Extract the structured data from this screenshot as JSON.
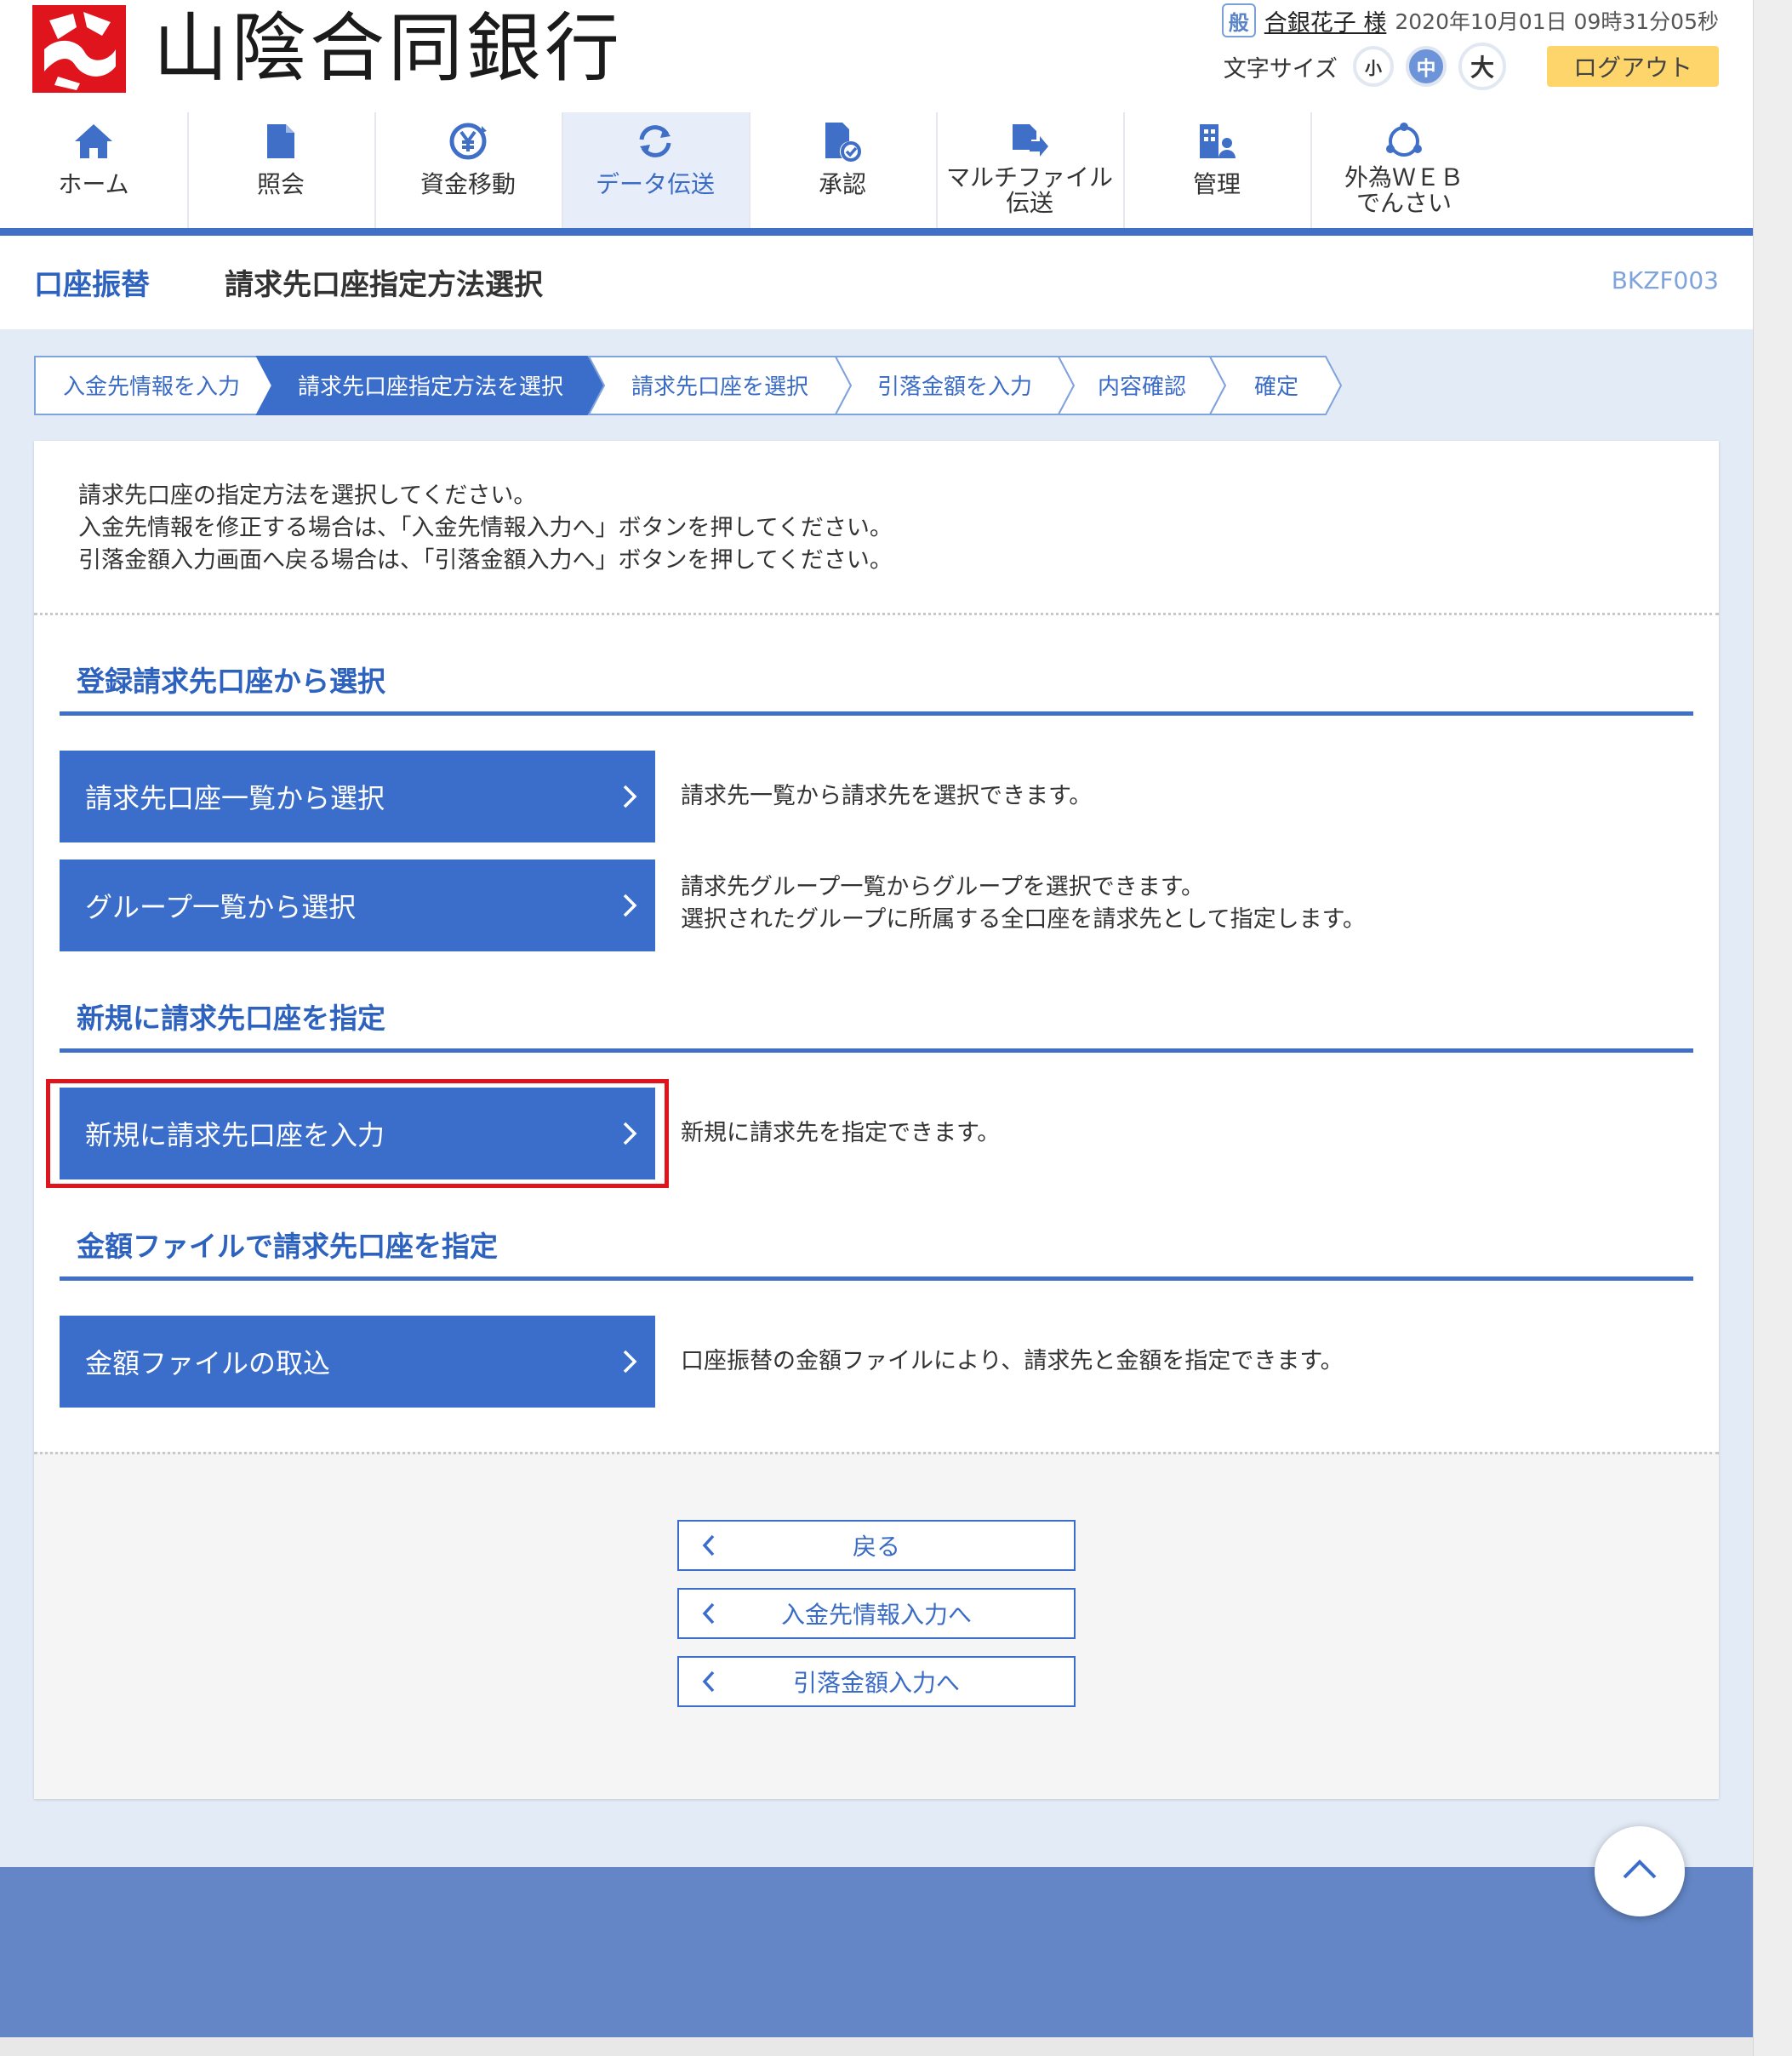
{
  "brand": {
    "name": "山陰合同銀行",
    "logo_text": "ご"
  },
  "user": {
    "badge": "般",
    "name": "合銀花子 様",
    "login_time": "2020年10月01日 09時31分05秒"
  },
  "font_size": {
    "label": "文字サイズ",
    "small": "小",
    "medium": "中",
    "large": "大",
    "selected": "中"
  },
  "logout_label": "ログアウト",
  "nav": {
    "active": "データ伝送",
    "items": [
      {
        "icon": "home-icon",
        "label": "ホーム"
      },
      {
        "icon": "document-icon",
        "label": "照会"
      },
      {
        "icon": "yen-transfer-icon",
        "label": "資金移動"
      },
      {
        "icon": "sync-icon",
        "label": "データ伝送"
      },
      {
        "icon": "approval-icon",
        "label": "承認"
      },
      {
        "icon": "file-transfer-icon",
        "label_line1": "マルチファイル",
        "label_line2": "伝送"
      },
      {
        "icon": "management-icon",
        "label": "管理"
      },
      {
        "icon": "globe-icon",
        "label_line1": "外為ＷＥＢ",
        "label_line2": "でんさい"
      }
    ]
  },
  "title": {
    "category": "口座振替",
    "main": "請求先口座指定方法選択",
    "screen_id": "BKZF003"
  },
  "steps": {
    "current_index": 1,
    "items": [
      "入金先情報を入力",
      "請求先口座指定方法を選択",
      "請求先口座を選択",
      "引落金額を入力",
      "内容確認",
      "確定"
    ]
  },
  "intro": {
    "line1": "請求先口座の指定方法を選択してください。",
    "line2": "入金先情報を修正する場合は、「入金先情報入力へ」ボタンを押してください。",
    "line3": "引落金額入力画面へ戻る場合は、「引落金額入力へ」ボタンを押してください。"
  },
  "sections": {
    "registered": {
      "title": "登録請求先口座から選択",
      "account_list_button": "請求先口座一覧から選択",
      "account_list_desc": "請求先一覧から請求先を選択できます。",
      "group_list_button": "グループ一覧から選択",
      "group_list_desc_line1": "請求先グループ一覧からグループを選択できます。",
      "group_list_desc_line2": "選択されたグループに所属する全口座を請求先として指定します。"
    },
    "new": {
      "title": "新規に請求先口座を指定",
      "button": "新規に請求先口座を入力",
      "desc": "新規に請求先を指定できます。"
    },
    "file": {
      "title": "金額ファイルで請求先口座を指定",
      "button": "金額ファイルの取込",
      "desc": "口座振替の金額ファイルにより、請求先と金額を指定できます。"
    }
  },
  "footer_buttons": {
    "back": "戻る",
    "to_deposit_info": "入金先情報入力へ",
    "to_debit_amount": "引落金額入力へ"
  },
  "colors": {
    "primary": "#3b6dcb",
    "accent_text": "#2e62bf",
    "logout": "#fdd56a",
    "highlight": "#e0141d",
    "footer": "#6486c6"
  }
}
